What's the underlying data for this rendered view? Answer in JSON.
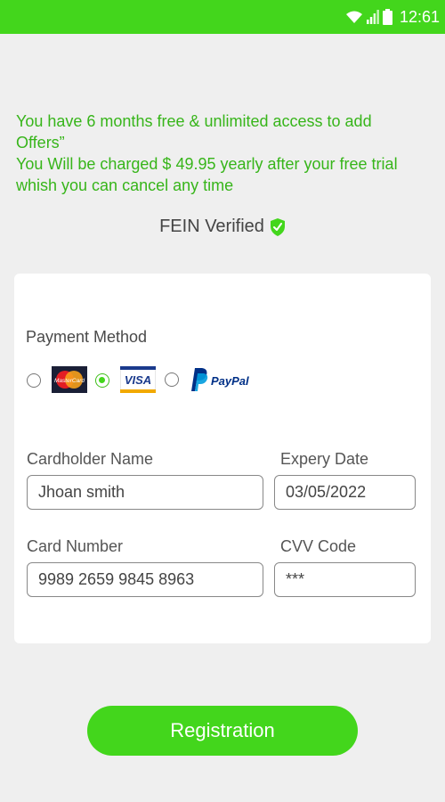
{
  "status_bar": {
    "time": "12:61",
    "icons": [
      "wifi-icon",
      "signal-icon",
      "battery-icon"
    ],
    "background": "#43d61c"
  },
  "intro": {
    "line1": "You have 6 months free & unlimited access to add Offers”",
    "line2": "You Will be charged $ 49.95 yearly after your free trial whish you can cancel any time",
    "color": "#37b51a"
  },
  "fein": {
    "label": "FEIN Verified",
    "icon": "shield-check-icon"
  },
  "payment": {
    "label": "Payment Method",
    "options": [
      {
        "name": "mastercard",
        "logo_text": "MasterCard",
        "selected": false
      },
      {
        "name": "visa",
        "logo_text": "VISA",
        "selected": true
      },
      {
        "name": "paypal",
        "logo_text": "PayPal",
        "selected": false
      }
    ]
  },
  "form": {
    "cardholder_label": "Cardholder Name",
    "cardholder_value": "Jhoan smith",
    "expiry_label": "Expery Date",
    "expiry_value": "03/05/2022",
    "card_number_label": "Card Number",
    "card_number_value": "9989 2659 9845 8963",
    "cvv_label": "CVV Code",
    "cvv_value": "***"
  },
  "registration_button": {
    "label": "Registration",
    "color": "#43d61c"
  }
}
